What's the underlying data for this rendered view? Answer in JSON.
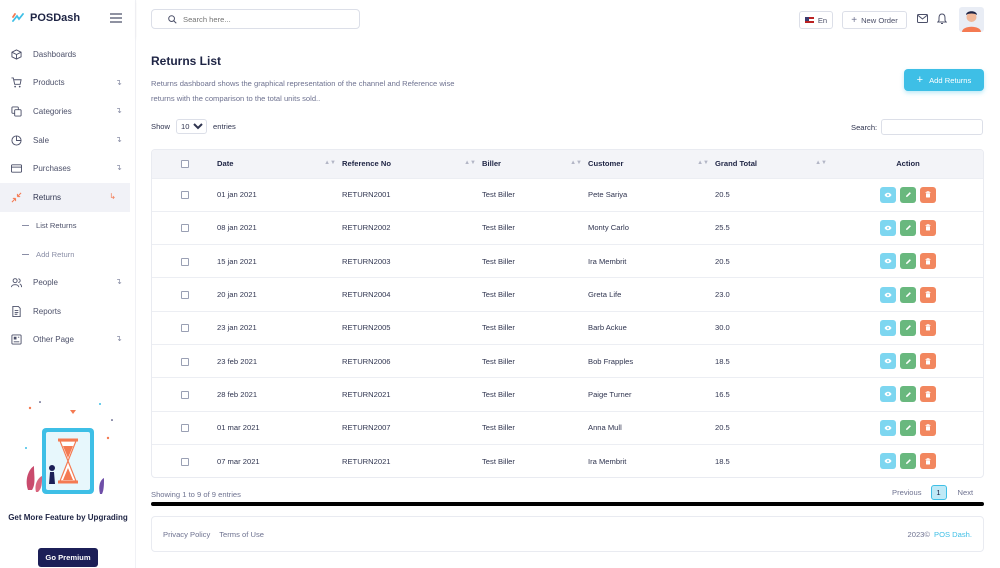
{
  "app": {
    "name": "POSDash"
  },
  "sidebar": {
    "items": [
      {
        "label": "Dashboards",
        "icon": "cube-icon",
        "arrow": ""
      },
      {
        "label": "Products",
        "icon": "cart-icon",
        "arrow": "↴"
      },
      {
        "label": "Categories",
        "icon": "copy-icon",
        "arrow": "↴"
      },
      {
        "label": "Sale",
        "icon": "piechart-icon",
        "arrow": "↴"
      },
      {
        "label": "Purchases",
        "icon": "card-icon",
        "arrow": "↴"
      },
      {
        "label": "Returns",
        "icon": "arrows-in-icon",
        "arrow": "↳"
      },
      {
        "label": "People",
        "icon": "users-icon",
        "arrow": "↴"
      },
      {
        "label": "Reports",
        "icon": "document-icon",
        "arrow": ""
      },
      {
        "label": "Other Page",
        "icon": "layout-icon",
        "arrow": "↴"
      }
    ],
    "sub_items": [
      "List Returns",
      "Add Return"
    ],
    "promo_title": "Get More Feature by Upgrading",
    "premium_label": "Go Premium"
  },
  "topbar": {
    "search_placeholder": "Search here...",
    "lang": "En",
    "new_order": "New Order"
  },
  "page": {
    "title": "Returns List",
    "description": "Returns dashboard shows the graphical representation of the channel and Reference wise returns with the comparison to the total units sold..",
    "add_button": "Add Returns",
    "show_label": "Show",
    "entries_value": "10",
    "entries_label": "entries",
    "search_label": "Search:"
  },
  "table": {
    "headers": [
      "Date",
      "Reference No",
      "Biller",
      "Customer",
      "Grand Total",
      "Action"
    ],
    "rows": [
      [
        "01 jan 2021",
        "RETURN2001",
        "Test Biller",
        "Pete Sariya",
        "20.5"
      ],
      [
        "08 jan 2021",
        "RETURN2002",
        "Test Biller",
        "Monty Carlo",
        "25.5"
      ],
      [
        "15 jan 2021",
        "RETURN2003",
        "Test Biller",
        "Ira Membrit",
        "20.5"
      ],
      [
        "20 jan 2021",
        "RETURN2004",
        "Test Biller",
        "Greta Life",
        "23.0"
      ],
      [
        "23 jan 2021",
        "RETURN2005",
        "Test Biller",
        "Barb Ackue",
        "30.0"
      ],
      [
        "23 feb 2021",
        "RETURN2006",
        "Test Biller",
        "Bob Frapples",
        "18.5"
      ],
      [
        "28 feb 2021",
        "RETURN2021",
        "Test Biller",
        "Paige Turner",
        "16.5"
      ],
      [
        "01 mar 2021",
        "RETURN2007",
        "Test Biller",
        "Anna Mull",
        "20.5"
      ],
      [
        "07 mar 2021",
        "RETURN2021",
        "Test Biller",
        "Ira Membrit",
        "18.5"
      ]
    ]
  },
  "pagination": {
    "info": "Showing 1 to 9 of 9 entries",
    "previous": "Previous",
    "current": "1",
    "next": "Next"
  },
  "footer": {
    "privacy": "Privacy Policy",
    "terms": "Terms of Use",
    "year": "2023©",
    "brand": "POS Dash."
  },
  "colors": {
    "accent": "#3ebfe6",
    "view": "#7dd6f0",
    "edit": "#69b87e",
    "delete": "#f2875f",
    "premium": "#1c1f57"
  }
}
